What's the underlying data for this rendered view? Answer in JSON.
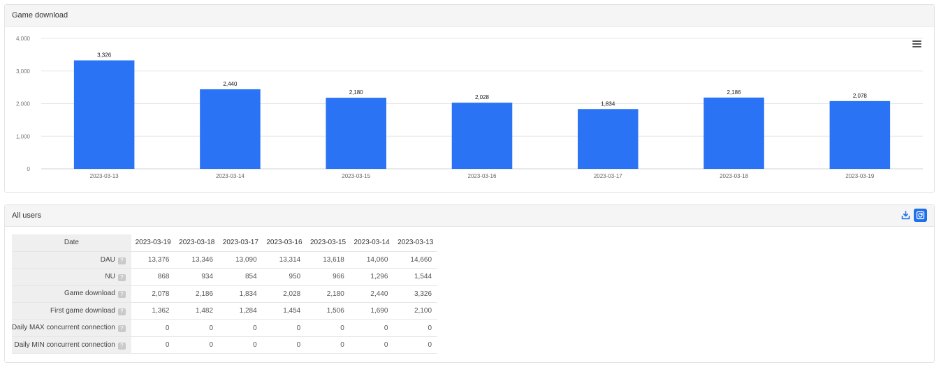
{
  "chart_panel": {
    "title": "Game download"
  },
  "chart_data": {
    "type": "bar",
    "title": "",
    "xlabel": "",
    "ylabel": "",
    "categories": [
      "2023-03-13",
      "2023-03-14",
      "2023-03-15",
      "2023-03-16",
      "2023-03-17",
      "2023-03-18",
      "2023-03-19"
    ],
    "values": [
      3326,
      2440,
      2180,
      2028,
      1834,
      2186,
      2078
    ],
    "value_labels": [
      "3,326",
      "2,440",
      "2,180",
      "2,028",
      "1,834",
      "2,186",
      "2,078"
    ],
    "yticks": [
      0,
      1000,
      2000,
      3000,
      4000
    ],
    "ytick_labels": [
      "0",
      "1,000",
      "2,000",
      "3,000",
      "4,000"
    ],
    "ylim": [
      0,
      4000
    ],
    "grid": true,
    "legend": "none",
    "bar_color": "#2b73f5"
  },
  "table_panel": {
    "title": "All users",
    "header": {
      "label": "Date",
      "dates": [
        "2023-03-19",
        "2023-03-18",
        "2023-03-17",
        "2023-03-16",
        "2023-03-15",
        "2023-03-14",
        "2023-03-13"
      ]
    },
    "help_glyph": "?",
    "rows": [
      {
        "label": "DAU",
        "values": [
          "13,376",
          "13,346",
          "13,090",
          "13,314",
          "13,618",
          "14,060",
          "14,660"
        ]
      },
      {
        "label": "NU",
        "values": [
          "868",
          "934",
          "854",
          "950",
          "966",
          "1,296",
          "1,544"
        ]
      },
      {
        "label": "Game download",
        "values": [
          "2,078",
          "2,186",
          "1,834",
          "2,028",
          "2,180",
          "2,440",
          "3,326"
        ]
      },
      {
        "label": "First game download",
        "values": [
          "1,362",
          "1,482",
          "1,284",
          "1,454",
          "1,506",
          "1,690",
          "2,100"
        ]
      },
      {
        "label": "Daily MAX concurrent connection",
        "values": [
          "0",
          "0",
          "0",
          "0",
          "0",
          "0",
          "0"
        ]
      },
      {
        "label": "Daily MIN concurrent connection",
        "values": [
          "0",
          "0",
          "0",
          "0",
          "0",
          "0",
          "0"
        ]
      }
    ]
  },
  "icons": {
    "menu": "hamburger-menu-icon",
    "download": "download-icon",
    "refresh": "refresh-icon",
    "help": "help-icon"
  },
  "colors": {
    "accent": "#1f6feb",
    "bar": "#2b73f5",
    "grid": "#e6e6e6"
  }
}
